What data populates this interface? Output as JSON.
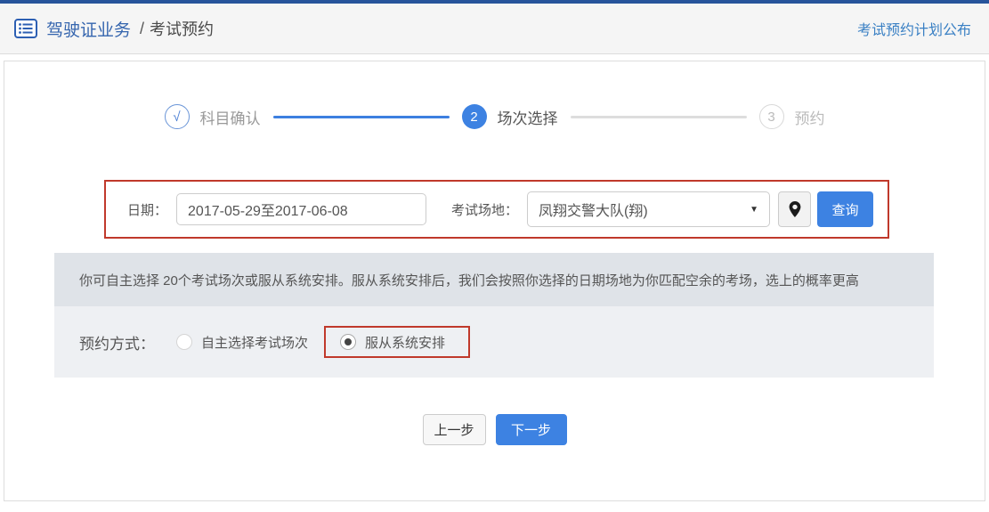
{
  "header": {
    "breadcrumb_root": "驾驶证业务",
    "breadcrumb_sep": "/",
    "breadcrumb_current": "考试预约",
    "link": "考试预约计划公布"
  },
  "steps": [
    {
      "marker": "√",
      "label": "科目确认",
      "state": "done"
    },
    {
      "marker": "2",
      "label": "场次选择",
      "state": "active"
    },
    {
      "marker": "3",
      "label": "预约",
      "state": "pending"
    }
  ],
  "filter": {
    "date_label": "日期：",
    "date_value": "2017-05-29至2017-06-08",
    "venue_label": "考试场地：",
    "venue_value": "凤翔交警大队(翔)",
    "dropdown_arrow": "▼",
    "query_button": "查询"
  },
  "notice": "你可自主选择 20个考试场次或服从系统安排。服从系统安排后，我们会按照你选择的日期场地为你匹配空余的考场，选上的概率更高",
  "booking": {
    "label": "预约方式：",
    "options": [
      {
        "label": "自主选择考试场次",
        "selected": false
      },
      {
        "label": "服从系统安排",
        "selected": true
      }
    ]
  },
  "actions": {
    "prev": "上一步",
    "next": "下一步"
  },
  "colors": {
    "accent": "#3d82e2",
    "highlight_red": "#c0392b",
    "top_bar": "#27549b",
    "notice_bg": "#dfe3e8",
    "option_bg": "#eef0f3"
  }
}
